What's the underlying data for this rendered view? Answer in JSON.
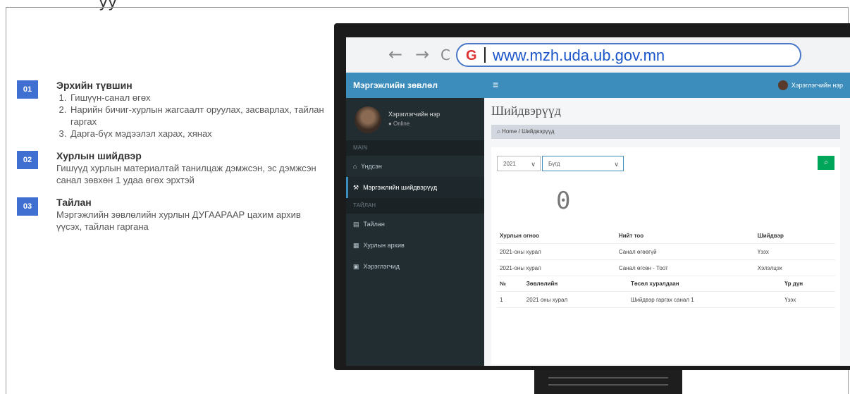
{
  "top_cut_text": "уу",
  "steps": [
    {
      "number": "01",
      "title": "Эрхийн түвшин",
      "items": [
        "Гишүүн-санал өгөх",
        "Нарийн бичиг-хурлын жагсаалт оруулах, засварлах, тайлан гаргах",
        "Дарга-бүх мэдээлэл харах, хянах"
      ]
    },
    {
      "number": "02",
      "title": "Хурлын шийдвэр",
      "text": "Гишүүд хурлын материалтай танилцаж дэмжсэн, эс дэмжсэн санал зөвхөн 1 удаа өгөх эрхтэй"
    },
    {
      "number": "03",
      "title": "Тайлан",
      "text": "Мэргэжлийн зөвлөлийн хурлын ДУГААРААР цахим архив үүсэх, тайлан гаргана"
    }
  ],
  "browser": {
    "back_icon": "arrow-left-icon",
    "forward_icon": "arrow-right-icon",
    "reload_icon": "reload-icon",
    "url": "www.mzh.uda.ub.gov.mn"
  },
  "app": {
    "brand": "Мэргэжлийн зөвлөл",
    "user_name": "Хэрэглэгчийн нэр",
    "user_status": "● Online",
    "nav_user": "Хэрэглэгчийн нэр",
    "section_main": "MAIN",
    "section_reports": "ТАЙЛАН",
    "menu": [
      {
        "label": "Үндсэн",
        "icon": "home-icon"
      },
      {
        "label": "Мэргэжлийн шийдвэрүүд",
        "icon": "gavel-icon"
      },
      {
        "label": "Тайлан",
        "icon": "chart-icon"
      },
      {
        "label": "Хурлын архив",
        "icon": "archive-icon"
      },
      {
        "label": "Хэрэглэгчид",
        "icon": "users-icon"
      }
    ],
    "page_title": "Шийдвэрүүд",
    "breadcrumb": "⌂ Home / Шийдвэрүүд",
    "select_year": "2021",
    "select_status": "Бүгд",
    "counter": "0",
    "table1_headers": [
      "Хурлын огноо",
      "Нийт тоо",
      "Шийдвэр"
    ],
    "table1_rows": [
      [
        "2021-оны хурал",
        "Санал өгөөгүй",
        "Үзэх"
      ],
      [
        "2021-оны хурал",
        "Санал өгсөн - Тоот",
        "Хэлэлцэх"
      ]
    ],
    "table2_headers": [
      "№",
      "Зөвлөлийн",
      "Төсөл хуралдаан",
      "Үр дүн"
    ],
    "table2_rows": [
      [
        "1",
        "2021 оны хурал",
        "Шийдвэр гаргах санал 1",
        "Үзэх"
      ]
    ]
  },
  "colors": {
    "badge": "#3f6fd1",
    "app_primary": "#3c8dbc",
    "sidebar": "#222d32",
    "search_button": "#00a65a"
  }
}
